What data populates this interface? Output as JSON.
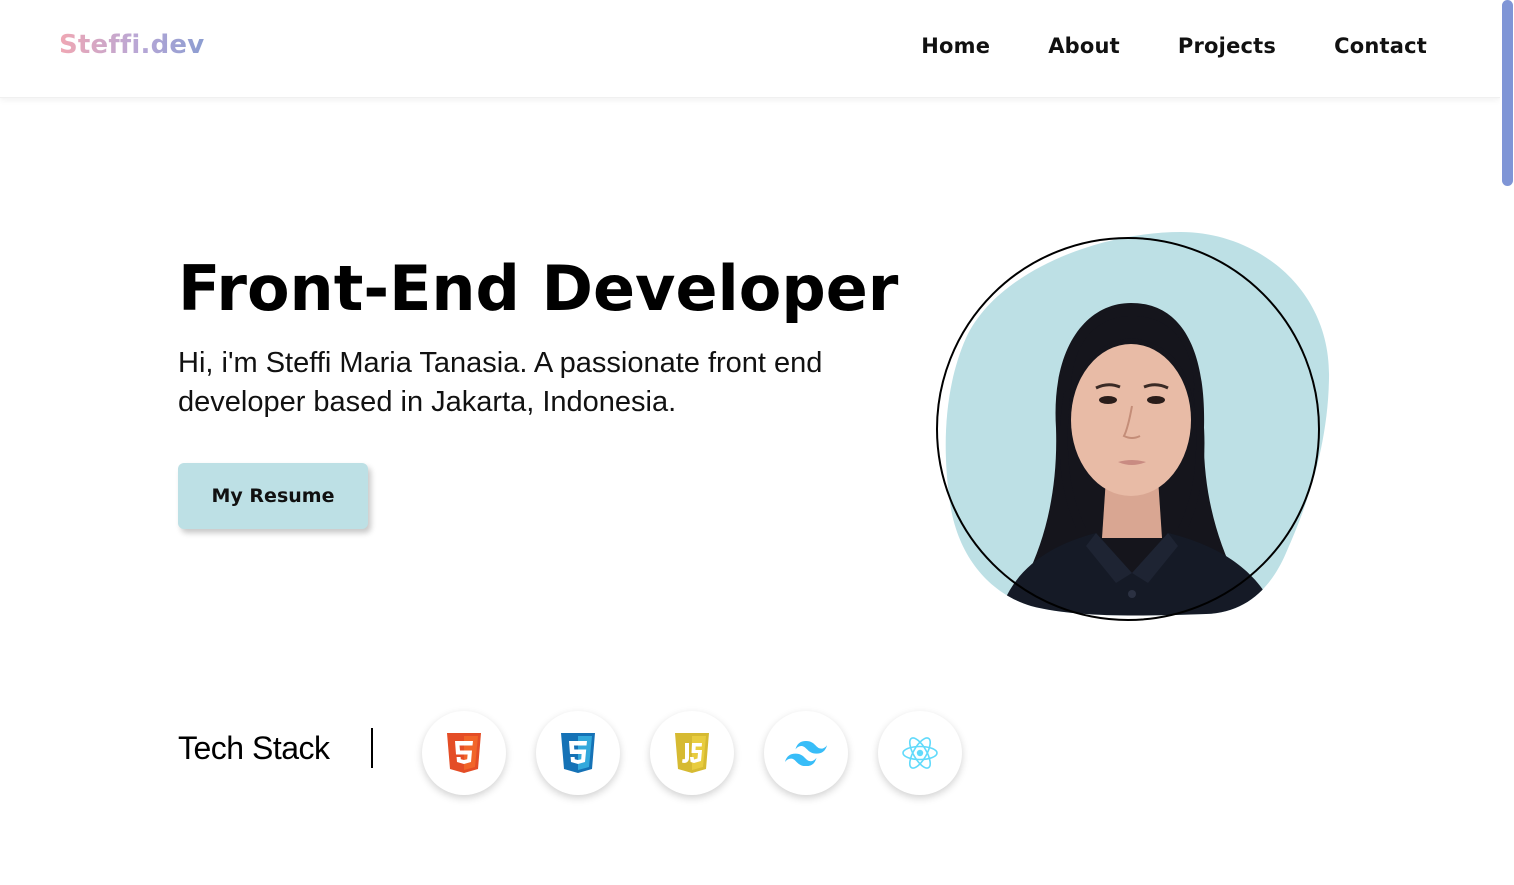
{
  "header": {
    "logo": "Steffi.dev",
    "nav": [
      {
        "label": "Home"
      },
      {
        "label": "About"
      },
      {
        "label": "Projects"
      },
      {
        "label": "Contact"
      }
    ]
  },
  "hero": {
    "title": "Front-End Developer",
    "description": "Hi, i'm Steffi Maria Tanasia. A passionate front end developer based in Jakarta, Indonesia.",
    "resume_button": "My Resume",
    "portrait": {
      "icon": "profile-photo",
      "blob_color": "#bde0e5"
    }
  },
  "tech_stack": {
    "label": "Tech Stack",
    "icons": [
      {
        "name": "html5-icon",
        "color": "#e44d26"
      },
      {
        "name": "css3-icon",
        "color": "#1572b6"
      },
      {
        "name": "javascript-icon",
        "color": "#d6ba32"
      },
      {
        "name": "tailwind-icon",
        "color": "#38bdf8"
      },
      {
        "name": "react-icon",
        "color": "#61dafb"
      }
    ]
  },
  "colors": {
    "accent": "#bde0e5",
    "scrollbar": "#7f95d6",
    "logo_gradient": [
      "#f0a7b3",
      "#8c9dd1"
    ]
  }
}
